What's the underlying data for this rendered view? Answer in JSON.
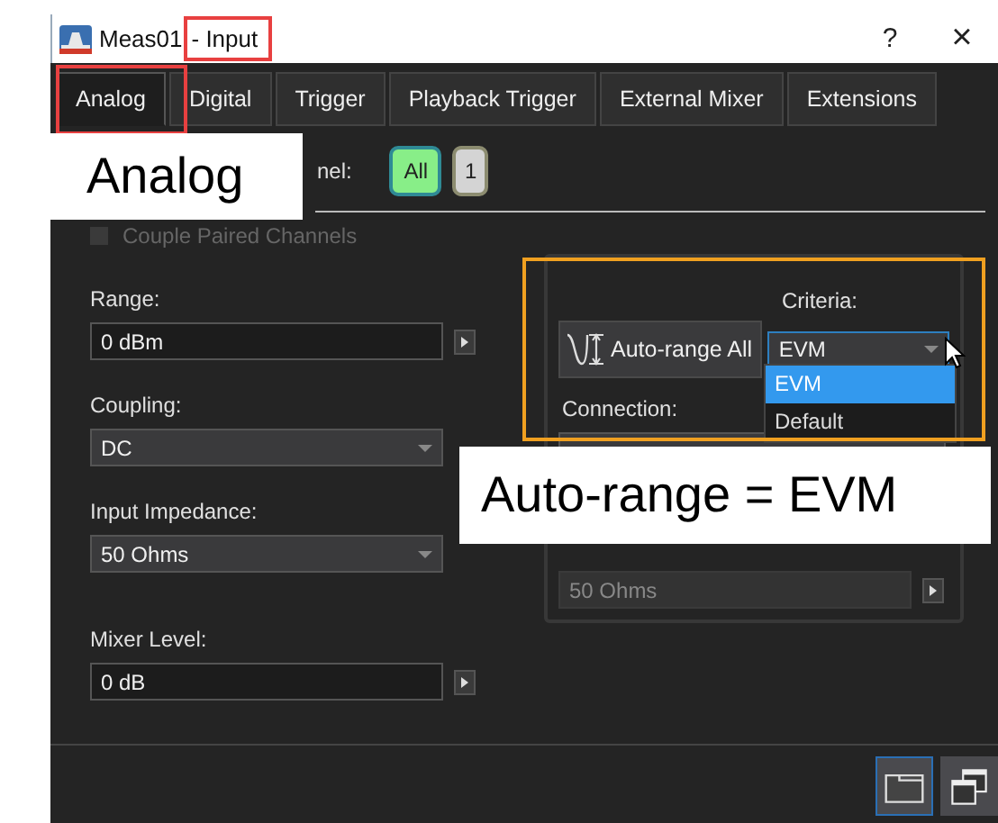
{
  "window": {
    "title": "Meas01",
    "title_suffix": "- Input",
    "help": "?",
    "close": "×"
  },
  "tabs": [
    {
      "label": "Analog",
      "selected": true
    },
    {
      "label": "Digital",
      "selected": false
    },
    {
      "label": "Trigger",
      "selected": false
    },
    {
      "label": "Playback Trigger",
      "selected": false
    },
    {
      "label": "External Mixer",
      "selected": false
    },
    {
      "label": "Extensions",
      "selected": false
    }
  ],
  "channel": {
    "label": "nel:",
    "buttons": [
      {
        "label": "All",
        "selected": true
      },
      {
        "label": "1",
        "selected": false
      }
    ]
  },
  "couple_paired_channels": {
    "label": "Couple Paired Channels",
    "disabled": true
  },
  "left_fields": [
    {
      "label": "Range:",
      "value": "0 dBm",
      "kind": "text",
      "step_button": true
    },
    {
      "label": "Coupling:",
      "value": "DC",
      "kind": "dropdown",
      "step_button": false
    },
    {
      "label": "Input Impedance:",
      "value": "50 Ohms",
      "kind": "dropdown",
      "step_button": false
    },
    {
      "label": "Mixer Level:",
      "value": "0 dB",
      "kind": "text",
      "step_button": true
    }
  ],
  "auto_range": {
    "button": "Auto-range All",
    "criteria_label": "Criteria:",
    "criteria_value": "EVM",
    "options": [
      {
        "label": "EVM",
        "selected": true
      },
      {
        "label": "Default",
        "selected": false
      }
    ],
    "connection_label": "Connection:",
    "impedance_value": "50 Ohms"
  },
  "callouts": [
    "Analog",
    "Auto-range = EVM"
  ],
  "footer_buttons": [
    {
      "selected": true
    },
    {
      "selected": false
    }
  ]
}
